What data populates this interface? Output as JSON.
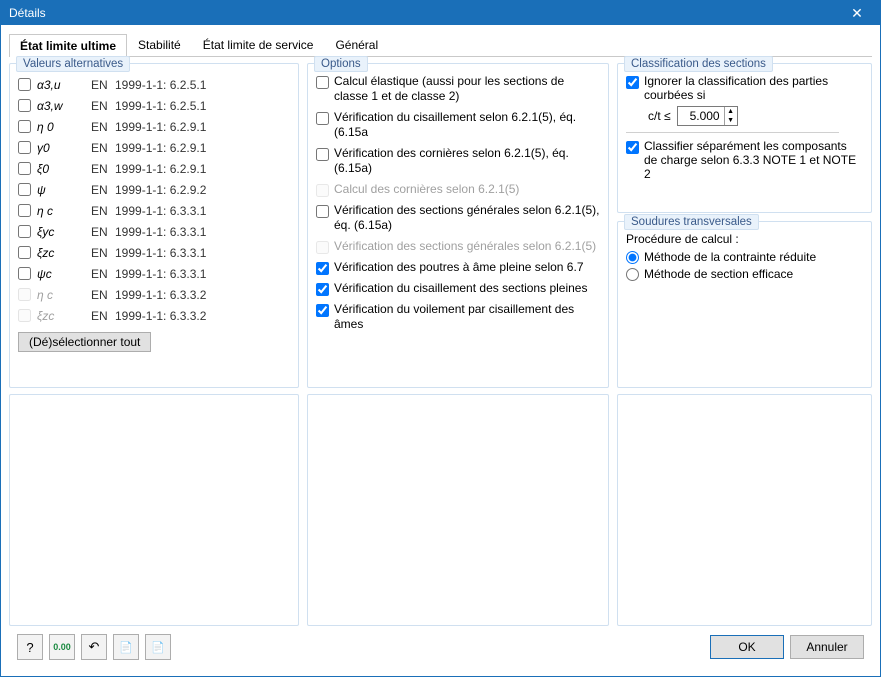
{
  "window": {
    "title": "Détails"
  },
  "tabs": [
    {
      "label": "État limite ultime",
      "active": true
    },
    {
      "label": "Stabilité"
    },
    {
      "label": "État limite de service"
    },
    {
      "label": "Général"
    }
  ],
  "groups": {
    "valeurs": "Valeurs alternatives",
    "options": "Options",
    "classif": "Classification des sections",
    "soudures": "Soudures transversales"
  },
  "valeurs": {
    "items": [
      {
        "sym": "α3,u",
        "en": "EN",
        "ref": "1999-1-1: 6.2.5.1",
        "checked": false,
        "disabled": false
      },
      {
        "sym": "α3,w",
        "en": "EN",
        "ref": "1999-1-1: 6.2.5.1",
        "checked": false,
        "disabled": false
      },
      {
        "sym": "η 0",
        "en": "EN",
        "ref": "1999-1-1: 6.2.9.1",
        "checked": false,
        "disabled": false
      },
      {
        "sym": "γ0",
        "en": "EN",
        "ref": "1999-1-1: 6.2.9.1",
        "checked": false,
        "disabled": false
      },
      {
        "sym": "ξ0",
        "en": "EN",
        "ref": "1999-1-1: 6.2.9.1",
        "checked": false,
        "disabled": false
      },
      {
        "sym": "ψ",
        "en": "EN",
        "ref": "1999-1-1: 6.2.9.2",
        "checked": false,
        "disabled": false
      },
      {
        "sym": "η c",
        "en": "EN",
        "ref": "1999-1-1: 6.3.3.1",
        "checked": false,
        "disabled": false
      },
      {
        "sym": "ξyc",
        "en": "EN",
        "ref": "1999-1-1: 6.3.3.1",
        "checked": false,
        "disabled": false
      },
      {
        "sym": "ξzc",
        "en": "EN",
        "ref": "1999-1-1: 6.3.3.1",
        "checked": false,
        "disabled": false
      },
      {
        "sym": "ψc",
        "en": "EN",
        "ref": "1999-1-1: 6.3.3.1",
        "checked": false,
        "disabled": false
      },
      {
        "sym": "η c",
        "en": "EN",
        "ref": "1999-1-1: 6.3.3.2",
        "checked": false,
        "disabled": true
      },
      {
        "sym": "ξzc",
        "en": "EN",
        "ref": "1999-1-1: 6.3.3.2",
        "checked": false,
        "disabled": true
      }
    ],
    "toggle_btn": "(Dé)sélectionner tout"
  },
  "options": {
    "items": [
      {
        "label": "Calcul élastique (aussi pour les sections de classe 1 et de classe 2)",
        "checked": false,
        "disabled": false
      },
      {
        "label": "Vérification du cisaillement selon 6.2.1(5), éq. (6.15a",
        "checked": false,
        "disabled": false
      },
      {
        "label": "Vérification des cornières selon 6.2.1(5), éq. (6.15a)",
        "checked": false,
        "disabled": false
      },
      {
        "label": "Calcul des cornières selon 6.2.1(5)",
        "checked": false,
        "disabled": true
      },
      {
        "label": "Vérification des sections générales selon 6.2.1(5), éq. (6.15a)",
        "checked": false,
        "disabled": false
      },
      {
        "label": "Vérification des sections générales selon 6.2.1(5)",
        "checked": false,
        "disabled": true
      },
      {
        "label": "Vérification des poutres à âme pleine selon 6.7",
        "checked": true,
        "disabled": false
      },
      {
        "label": "Vérification du cisaillement des sections pleines",
        "checked": true,
        "disabled": false
      },
      {
        "label": "Vérification du voilement par cisaillement des âmes",
        "checked": true,
        "disabled": false
      }
    ]
  },
  "classification": {
    "ignore_curved": {
      "label": "Ignorer la classification des parties courbées si",
      "checked": true
    },
    "ct_label": "c/t ≤",
    "ct_value": "5.000",
    "classifier_sep": {
      "label": "Classifier séparément les composants de charge selon 6.3.3 NOTE 1 et NOTE 2",
      "checked": true
    }
  },
  "soudures": {
    "procedure_label": "Procédure de calcul :",
    "radios": [
      {
        "label": "Méthode de la contrainte réduite",
        "checked": true
      },
      {
        "label": "Méthode de section efficace",
        "checked": false
      }
    ]
  },
  "footer": {
    "icons": [
      "❔",
      "0̲.0̲0̲",
      "↶",
      "⎙",
      "⎙+"
    ],
    "ok": "OK",
    "cancel": "Annuler"
  }
}
